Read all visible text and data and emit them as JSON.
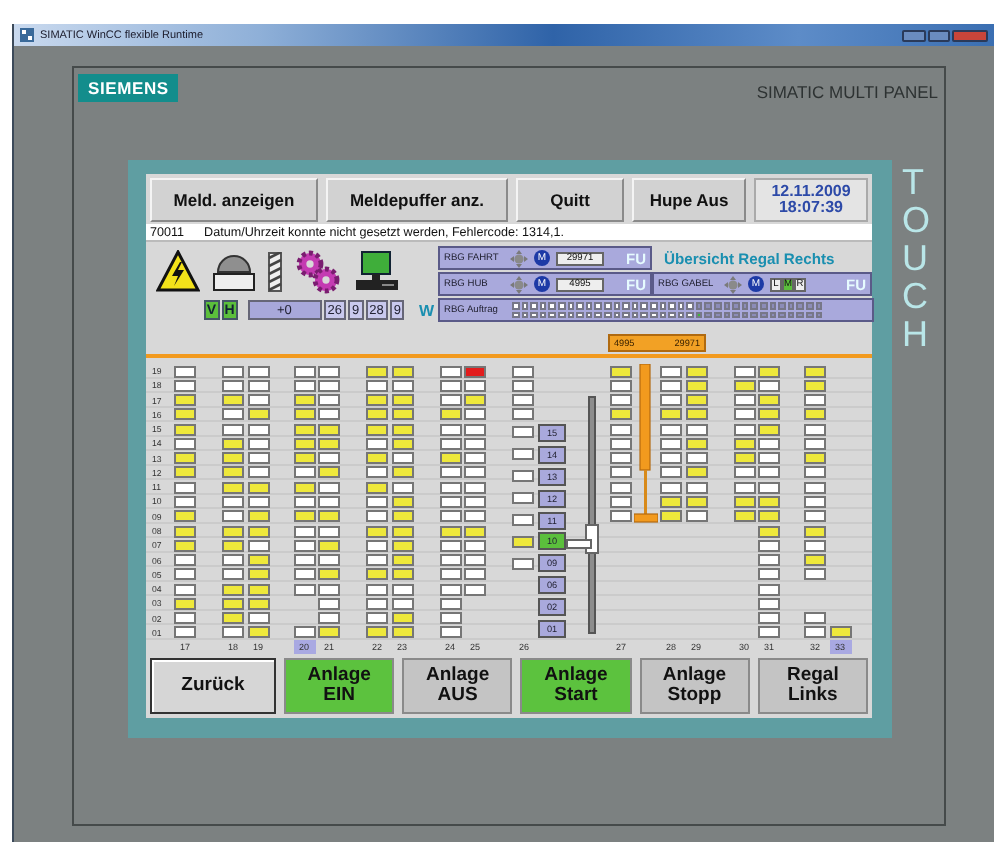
{
  "window": {
    "title": "SIMATIC WinCC flexible Runtime"
  },
  "panel": {
    "brand": "SIEMENS",
    "model": "SIMATIC MULTI PANEL",
    "touch_label": "TOUCH"
  },
  "toolbar": {
    "buttons": [
      "Meld. anzeigen",
      "Meldepuffer anz.",
      "Quitt",
      "Hupe Aus"
    ],
    "date": "12.11.2009",
    "time": "18:07:39"
  },
  "message": {
    "code": "70011",
    "text": "Datum/Uhrzeit konnte nicht gesetzt werden, Fehlercode: 1314,1."
  },
  "status": {
    "title": "Übersicht Regal Rechts",
    "indicators": [
      {
        "label": "V",
        "on": true
      },
      {
        "label": "H",
        "on": true
      }
    ],
    "offset": "+0",
    "counters": [
      "26",
      "9",
      "28",
      "9"
    ],
    "mode": "W",
    "drives": [
      {
        "label": "RBG FAHRT",
        "motor": "M",
        "value": "29971",
        "fu": "FU"
      },
      {
        "label": "RBG HUB",
        "motor": "M",
        "value": "4995",
        "fu": "FU"
      },
      {
        "label": "RBG GABEL",
        "motor": "M",
        "fu": "FU",
        "positions": [
          {
            "label": "L",
            "selected": false
          },
          {
            "label": "M",
            "selected": true
          },
          {
            "label": "R",
            "selected": false
          }
        ]
      }
    ],
    "order": {
      "label": "RBG Auftrag",
      "rows": [
        [
          {
            "kind": "done"
          },
          {
            "kind": "done"
          },
          {
            "kind": "done"
          },
          {
            "kind": "done"
          },
          {
            "kind": "done"
          },
          {
            "kind": "done"
          },
          {
            "kind": "done"
          },
          {
            "kind": "done"
          },
          {
            "kind": "done"
          },
          {
            "kind": "done"
          },
          {
            "kind": "done"
          },
          {
            "kind": "done"
          },
          {
            "kind": "done"
          },
          {
            "kind": "done"
          },
          {
            "kind": "done"
          },
          {
            "kind": "done"
          },
          {
            "kind": "done"
          },
          {
            "kind": "done"
          },
          {
            "kind": "done"
          },
          {
            "kind": "done"
          },
          {
            "kind": "open"
          },
          {
            "kind": "open"
          },
          {
            "kind": "open"
          },
          {
            "kind": "open"
          },
          {
            "kind": "open"
          },
          {
            "kind": "open"
          },
          {
            "kind": "open"
          },
          {
            "kind": "open"
          },
          {
            "kind": "open"
          },
          {
            "kind": "open"
          },
          {
            "kind": "open"
          },
          {
            "kind": "open"
          },
          {
            "kind": "open"
          },
          {
            "kind": "open"
          }
        ],
        [
          {
            "kind": "done"
          },
          {
            "kind": "done"
          },
          {
            "kind": "done"
          },
          {
            "kind": "done"
          },
          {
            "kind": "done"
          },
          {
            "kind": "done"
          },
          {
            "kind": "done"
          },
          {
            "kind": "done"
          },
          {
            "kind": "done"
          },
          {
            "kind": "done"
          },
          {
            "kind": "done"
          },
          {
            "kind": "done"
          },
          {
            "kind": "done"
          },
          {
            "kind": "done"
          },
          {
            "kind": "done"
          },
          {
            "kind": "done"
          },
          {
            "kind": "done"
          },
          {
            "kind": "done"
          },
          {
            "kind": "done"
          },
          {
            "kind": "done"
          },
          {
            "kind": "active"
          },
          {
            "kind": "open"
          },
          {
            "kind": "open"
          },
          {
            "kind": "open"
          },
          {
            "kind": "open"
          },
          {
            "kind": "open"
          },
          {
            "kind": "open"
          },
          {
            "kind": "open"
          },
          {
            "kind": "open"
          },
          {
            "kind": "open"
          },
          {
            "kind": "open"
          },
          {
            "kind": "open"
          },
          {
            "kind": "open"
          },
          {
            "kind": "open"
          }
        ]
      ]
    }
  },
  "rack": {
    "row_labels": [
      "19",
      "18",
      "17",
      "16",
      "15",
      "14",
      "13",
      "12",
      "11",
      "10",
      "09",
      "08",
      "07",
      "06",
      "05",
      "04",
      "03",
      "02",
      "01"
    ],
    "crane": {
      "values": [
        "4995",
        "29971"
      ]
    },
    "left_groups": [
      {
        "columns": [
          {
            "label": "17",
            "selected": false,
            "cells": [
              {
                "kind": "empty"
              },
              {
                "kind": "empty"
              },
              {
                "kind": "full"
              },
              {
                "kind": "full"
              },
              {
                "kind": "full"
              },
              {
                "kind": "empty"
              },
              {
                "kind": "full"
              },
              {
                "kind": "full"
              },
              {
                "kind": "empty"
              },
              {
                "kind": "empty"
              },
              {
                "kind": "full"
              },
              {
                "kind": "full"
              },
              {
                "kind": "full"
              },
              {
                "kind": "empty"
              },
              {
                "kind": "empty"
              },
              {
                "kind": "empty"
              },
              {
                "kind": "full"
              },
              {
                "kind": "empty"
              },
              {
                "kind": "empty"
              }
            ]
          }
        ]
      },
      {
        "columns": [
          {
            "label": "18",
            "selected": false,
            "cells": [
              {
                "kind": "empty"
              },
              {
                "kind": "empty"
              },
              {
                "kind": "full"
              },
              {
                "kind": "empty"
              },
              {
                "kind": "empty"
              },
              {
                "kind": "full"
              },
              {
                "kind": "full"
              },
              {
                "kind": "full"
              },
              {
                "kind": "full"
              },
              {
                "kind": "empty"
              },
              {
                "kind": "empty"
              },
              {
                "kind": "full"
              },
              {
                "kind": "full"
              },
              {
                "kind": "empty"
              },
              {
                "kind": "empty"
              },
              {
                "kind": "full"
              },
              {
                "kind": "full"
              },
              {
                "kind": "full"
              },
              {
                "kind": "empty"
              }
            ]
          },
          {
            "label": "19",
            "selected": false,
            "cells": [
              {
                "kind": "empty"
              },
              {
                "kind": "empty"
              },
              {
                "kind": "empty"
              },
              {
                "kind": "full"
              },
              {
                "kind": "empty"
              },
              {
                "kind": "empty"
              },
              {
                "kind": "empty"
              },
              {
                "kind": "empty"
              },
              {
                "kind": "full"
              },
              {
                "kind": "empty"
              },
              {
                "kind": "full"
              },
              {
                "kind": "full"
              },
              {
                "kind": "empty"
              },
              {
                "kind": "full"
              },
              {
                "kind": "full"
              },
              {
                "kind": "full"
              },
              {
                "kind": "full"
              },
              {
                "kind": "empty"
              },
              {
                "kind": "full"
              }
            ]
          }
        ]
      },
      {
        "columns": [
          {
            "label": "20",
            "selected": true,
            "cells": [
              {
                "kind": "empty"
              },
              {
                "kind": "empty"
              },
              {
                "kind": "full"
              },
              {
                "kind": "full"
              },
              {
                "kind": "full"
              },
              {
                "kind": "full"
              },
              {
                "kind": "full"
              },
              {
                "kind": "empty"
              },
              {
                "kind": "full"
              },
              {
                "kind": "empty"
              },
              {
                "kind": "full"
              },
              {
                "kind": "empty"
              },
              {
                "kind": "empty"
              },
              {
                "kind": "empty"
              },
              {
                "kind": "empty"
              },
              {
                "kind": "empty"
              },
              {
                "kind": "gap"
              },
              {
                "kind": "gap"
              },
              {
                "kind": "empty"
              }
            ]
          },
          {
            "label": "21",
            "selected": false,
            "cells": [
              {
                "kind": "empty"
              },
              {
                "kind": "empty"
              },
              {
                "kind": "empty"
              },
              {
                "kind": "empty"
              },
              {
                "kind": "full"
              },
              {
                "kind": "full"
              },
              {
                "kind": "empty"
              },
              {
                "kind": "full"
              },
              {
                "kind": "empty"
              },
              {
                "kind": "empty"
              },
              {
                "kind": "full"
              },
              {
                "kind": "empty"
              },
              {
                "kind": "full"
              },
              {
                "kind": "empty"
              },
              {
                "kind": "full"
              },
              {
                "kind": "empty"
              },
              {
                "kind": "empty"
              },
              {
                "kind": "empty"
              },
              {
                "kind": "full"
              }
            ]
          }
        ]
      },
      {
        "columns": [
          {
            "label": "22",
            "selected": false,
            "cells": [
              {
                "kind": "full"
              },
              {
                "kind": "empty"
              },
              {
                "kind": "full"
              },
              {
                "kind": "full"
              },
              {
                "kind": "full"
              },
              {
                "kind": "empty"
              },
              {
                "kind": "full"
              },
              {
                "kind": "empty"
              },
              {
                "kind": "full"
              },
              {
                "kind": "empty"
              },
              {
                "kind": "empty"
              },
              {
                "kind": "full"
              },
              {
                "kind": "empty"
              },
              {
                "kind": "empty"
              },
              {
                "kind": "full"
              },
              {
                "kind": "empty"
              },
              {
                "kind": "empty"
              },
              {
                "kind": "empty"
              },
              {
                "kind": "full"
              }
            ]
          },
          {
            "label": "23",
            "selected": false,
            "cells": [
              {
                "kind": "full"
              },
              {
                "kind": "empty"
              },
              {
                "kind": "full"
              },
              {
                "kind": "full"
              },
              {
                "kind": "full"
              },
              {
                "kind": "full"
              },
              {
                "kind": "empty"
              },
              {
                "kind": "full"
              },
              {
                "kind": "empty"
              },
              {
                "kind": "full"
              },
              {
                "kind": "full"
              },
              {
                "kind": "full"
              },
              {
                "kind": "full"
              },
              {
                "kind": "full"
              },
              {
                "kind": "full"
              },
              {
                "kind": "empty"
              },
              {
                "kind": "empty"
              },
              {
                "kind": "full"
              },
              {
                "kind": "full"
              }
            ]
          }
        ]
      },
      {
        "columns": [
          {
            "label": "24",
            "selected": false,
            "cells": [
              {
                "kind": "empty"
              },
              {
                "kind": "empty"
              },
              {
                "kind": "empty"
              },
              {
                "kind": "full"
              },
              {
                "kind": "empty"
              },
              {
                "kind": "empty"
              },
              {
                "kind": "full"
              },
              {
                "kind": "empty"
              },
              {
                "kind": "empty"
              },
              {
                "kind": "empty"
              },
              {
                "kind": "empty"
              },
              {
                "kind": "full"
              },
              {
                "kind": "empty"
              },
              {
                "kind": "empty"
              },
              {
                "kind": "empty"
              },
              {
                "kind": "empty"
              },
              {
                "kind": "empty"
              },
              {
                "kind": "empty"
              },
              {
                "kind": "empty"
              }
            ]
          },
          {
            "label": "25",
            "selected": false,
            "cells": [
              {
                "kind": "fault"
              },
              {
                "kind": "empty"
              },
              {
                "kind": "full"
              },
              {
                "kind": "empty"
              },
              {
                "kind": "empty"
              },
              {
                "kind": "empty"
              },
              {
                "kind": "empty"
              },
              {
                "kind": "empty"
              },
              {
                "kind": "empty"
              },
              {
                "kind": "empty"
              },
              {
                "kind": "empty"
              },
              {
                "kind": "full"
              },
              {
                "kind": "empty"
              },
              {
                "kind": "empty"
              },
              {
                "kind": "empty"
              },
              {
                "kind": "empty"
              },
              {
                "kind": "gap"
              },
              {
                "kind": "gap"
              },
              {
                "kind": "gap"
              }
            ]
          }
        ]
      }
    ],
    "lift": {
      "column": {
        "label": "26",
        "selected": false,
        "upper_cells": [
          {
            "kind": "empty"
          },
          {
            "kind": "empty"
          },
          {
            "kind": "empty"
          },
          {
            "kind": "empty"
          }
        ]
      },
      "stops": [
        {
          "label": "15",
          "selected": false,
          "cell": {
            "kind": "empty"
          }
        },
        {
          "label": "14",
          "selected": false,
          "cell": {
            "kind": "empty"
          }
        },
        {
          "label": "13",
          "selected": false,
          "cell": {
            "kind": "empty"
          }
        },
        {
          "label": "12",
          "selected": false,
          "cell": {
            "kind": "empty"
          }
        },
        {
          "label": "11",
          "selected": false,
          "cell": {
            "kind": "empty"
          }
        },
        {
          "label": "10",
          "selected": true,
          "cell": {
            "kind": "full"
          }
        },
        {
          "label": "09",
          "selected": false,
          "cell": {
            "kind": "empty"
          }
        },
        {
          "label": "06",
          "selected": false,
          "cell": {
            "kind": "gap"
          }
        },
        {
          "label": "02",
          "selected": false,
          "cell": {
            "kind": "gap"
          }
        },
        {
          "label": "01",
          "selected": false,
          "cell": {
            "kind": "gap"
          }
        }
      ]
    },
    "right_groups": [
      {
        "columns": [
          {
            "label": "27",
            "selected": false,
            "cells": [
              {
                "kind": "full"
              },
              {
                "kind": "empty"
              },
              {
                "kind": "empty"
              },
              {
                "kind": "full"
              },
              {
                "kind": "empty"
              },
              {
                "kind": "empty"
              },
              {
                "kind": "empty"
              },
              {
                "kind": "empty"
              },
              {
                "kind": "empty"
              },
              {
                "kind": "empty"
              },
              {
                "kind": "empty"
              },
              {
                "kind": "gap"
              },
              {
                "kind": "gap"
              },
              {
                "kind": "gap"
              },
              {
                "kind": "gap"
              },
              {
                "kind": "gap"
              },
              {
                "kind": "gap"
              },
              {
                "kind": "gap"
              },
              {
                "kind": "gap"
              }
            ]
          }
        ]
      },
      {
        "columns": [
          {
            "label": "28",
            "selected": false,
            "cells": [
              {
                "kind": "empty"
              },
              {
                "kind": "empty"
              },
              {
                "kind": "empty"
              },
              {
                "kind": "full"
              },
              {
                "kind": "empty"
              },
              {
                "kind": "empty"
              },
              {
                "kind": "empty"
              },
              {
                "kind": "empty"
              },
              {
                "kind": "empty"
              },
              {
                "kind": "full"
              },
              {
                "kind": "full"
              },
              {
                "kind": "gap"
              },
              {
                "kind": "gap"
              },
              {
                "kind": "gap"
              },
              {
                "kind": "gap"
              },
              {
                "kind": "gap"
              },
              {
                "kind": "gap"
              },
              {
                "kind": "gap"
              },
              {
                "kind": "gap"
              }
            ]
          },
          {
            "label": "29",
            "selected": false,
            "cells": [
              {
                "kind": "full"
              },
              {
                "kind": "full"
              },
              {
                "kind": "full"
              },
              {
                "kind": "full"
              },
              {
                "kind": "empty"
              },
              {
                "kind": "full"
              },
              {
                "kind": "empty"
              },
              {
                "kind": "full"
              },
              {
                "kind": "empty"
              },
              {
                "kind": "full"
              },
              {
                "kind": "empty"
              },
              {
                "kind": "gap"
              },
              {
                "kind": "gap"
              },
              {
                "kind": "gap"
              },
              {
                "kind": "gap"
              },
              {
                "kind": "gap"
              },
              {
                "kind": "gap"
              },
              {
                "kind": "gap"
              },
              {
                "kind": "gap"
              }
            ]
          }
        ]
      },
      {
        "columns": [
          {
            "label": "30",
            "selected": false,
            "cells": [
              {
                "kind": "empty"
              },
              {
                "kind": "full"
              },
              {
                "kind": "empty"
              },
              {
                "kind": "empty"
              },
              {
                "kind": "empty"
              },
              {
                "kind": "full"
              },
              {
                "kind": "full"
              },
              {
                "kind": "empty"
              },
              {
                "kind": "empty"
              },
              {
                "kind": "full"
              },
              {
                "kind": "full"
              },
              {
                "kind": "gap"
              },
              {
                "kind": "gap"
              },
              {
                "kind": "gap"
              },
              {
                "kind": "gap"
              },
              {
                "kind": "gap"
              },
              {
                "kind": "gap"
              },
              {
                "kind": "gap"
              },
              {
                "kind": "gap"
              }
            ]
          },
          {
            "label": "31",
            "selected": false,
            "cells": [
              {
                "kind": "full"
              },
              {
                "kind": "empty"
              },
              {
                "kind": "full"
              },
              {
                "kind": "full"
              },
              {
                "kind": "full"
              },
              {
                "kind": "empty"
              },
              {
                "kind": "empty"
              },
              {
                "kind": "empty"
              },
              {
                "kind": "empty"
              },
              {
                "kind": "full"
              },
              {
                "kind": "full"
              },
              {
                "kind": "full"
              },
              {
                "kind": "empty"
              },
              {
                "kind": "empty"
              },
              {
                "kind": "empty"
              },
              {
                "kind": "empty"
              },
              {
                "kind": "empty"
              },
              {
                "kind": "empty"
              },
              {
                "kind": "empty"
              }
            ]
          }
        ]
      },
      {
        "columns": [
          {
            "label": "32",
            "selected": false,
            "cells": [
              {
                "kind": "full"
              },
              {
                "kind": "full"
              },
              {
                "kind": "empty"
              },
              {
                "kind": "full"
              },
              {
                "kind": "empty"
              },
              {
                "kind": "empty"
              },
              {
                "kind": "full"
              },
              {
                "kind": "empty"
              },
              {
                "kind": "empty"
              },
              {
                "kind": "empty"
              },
              {
                "kind": "empty"
              },
              {
                "kind": "full"
              },
              {
                "kind": "empty"
              },
              {
                "kind": "full"
              },
              {
                "kind": "empty"
              },
              {
                "kind": "gap"
              },
              {
                "kind": "gap"
              },
              {
                "kind": "empty"
              },
              {
                "kind": "empty"
              }
            ]
          },
          {
            "label": "33",
            "selected": true,
            "cells": [
              {
                "kind": "gap"
              },
              {
                "kind": "gap"
              },
              {
                "kind": "gap"
              },
              {
                "kind": "gap"
              },
              {
                "kind": "gap"
              },
              {
                "kind": "gap"
              },
              {
                "kind": "gap"
              },
              {
                "kind": "gap"
              },
              {
                "kind": "gap"
              },
              {
                "kind": "gap"
              },
              {
                "kind": "gap"
              },
              {
                "kind": "gap"
              },
              {
                "kind": "gap"
              },
              {
                "kind": "gap"
              },
              {
                "kind": "gap"
              },
              {
                "kind": "gap"
              },
              {
                "kind": "gap"
              },
              {
                "kind": "gap"
              },
              {
                "kind": "full"
              }
            ]
          }
        ]
      }
    ]
  },
  "footer": {
    "buttons": [
      {
        "label": "Zurück",
        "kind": "plain",
        "active": false
      },
      {
        "label": "Anlage EIN",
        "kind": "toggle",
        "active": true
      },
      {
        "label": "Anlage AUS",
        "kind": "toggle",
        "active": false
      },
      {
        "label": "Anlage Start",
        "kind": "toggle",
        "active": true
      },
      {
        "label": "Anlage Stopp",
        "kind": "toggle",
        "active": false
      },
      {
        "label": "Regal Links",
        "kind": "toggle",
        "active": false
      }
    ]
  }
}
